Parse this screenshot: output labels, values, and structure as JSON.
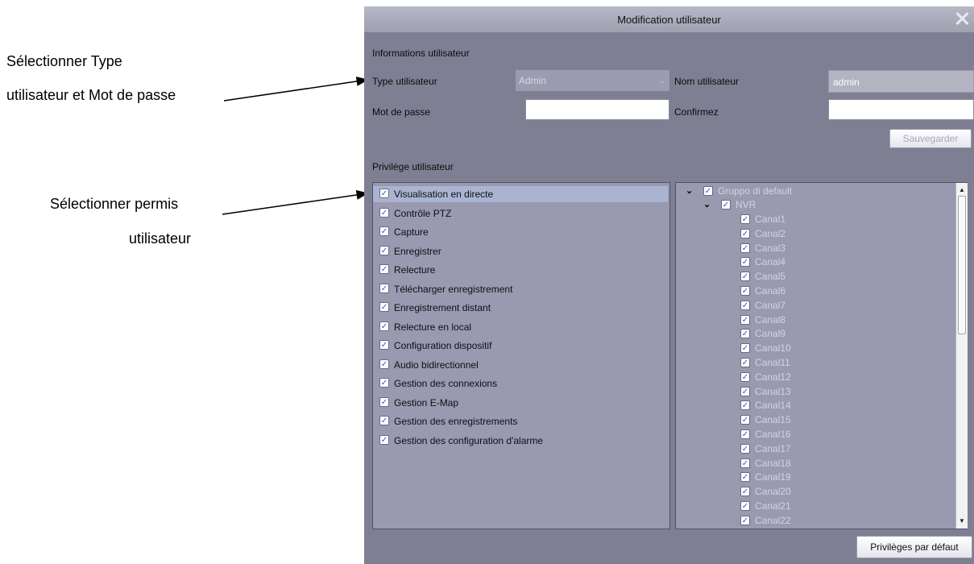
{
  "annotations": {
    "type_line1": "Sélectionner Type",
    "type_line2": "utilisateur et Mot de passe",
    "perm_line1": "Sélectionner permis",
    "perm_line2": "utilisateur"
  },
  "dialog": {
    "title": "Modification utilisateur",
    "info_section": "Informations utilisateur",
    "type_label": "Type utilisateur",
    "type_value": "Admin",
    "name_label": "Nom utilisateur",
    "name_value": "admin",
    "password_label": "Mot de passe",
    "password_value": "",
    "confirm_label": "Confirmez",
    "confirm_value": "",
    "save_button": "Sauvegarder",
    "privilege_section": "Privilège utilisateur",
    "default_button": "Privilèges par défaut"
  },
  "privileges": [
    {
      "label": "Visualisation en directe",
      "checked": true,
      "selected": true
    },
    {
      "label": "Contrôle PTZ",
      "checked": true
    },
    {
      "label": "Capture",
      "checked": true
    },
    {
      "label": "Enregistrer",
      "checked": true
    },
    {
      "label": "Relecture",
      "checked": true
    },
    {
      "label": "Télécharger enregistrement",
      "checked": true
    },
    {
      "label": "Enregistrement distant",
      "checked": true
    },
    {
      "label": "Relecture en local",
      "checked": true
    },
    {
      "label": "Configuration dispositif",
      "checked": true
    },
    {
      "label": "Audio bidirectionnel",
      "checked": true
    },
    {
      "label": "Gestion des connexions",
      "checked": true
    },
    {
      "label": "Gestion E-Map",
      "checked": true
    },
    {
      "label": "Gestion des enregistrements",
      "checked": true
    },
    {
      "label": "Gestion des configuration d'alarme",
      "checked": true
    }
  ],
  "tree": {
    "group": "Gruppo di default",
    "device": "NVR",
    "channels": [
      "Canal1",
      "Canal2",
      "Canal3",
      "Canal4",
      "Canal5",
      "Canal6",
      "Canal7",
      "Canal8",
      "Canal9",
      "Canal10",
      "Canal11",
      "Canal12",
      "Canal13",
      "Canal14",
      "Canal15",
      "Canal16",
      "Canal17",
      "Canal18",
      "Canal19",
      "Canal20",
      "Canal21",
      "Canal22"
    ]
  },
  "icons": {
    "close": "close-icon",
    "checkbox": "check-icon",
    "expand": "chevron-down-icon",
    "scroll_up": "scroll-up-icon",
    "scroll_down": "scroll-down-icon"
  }
}
